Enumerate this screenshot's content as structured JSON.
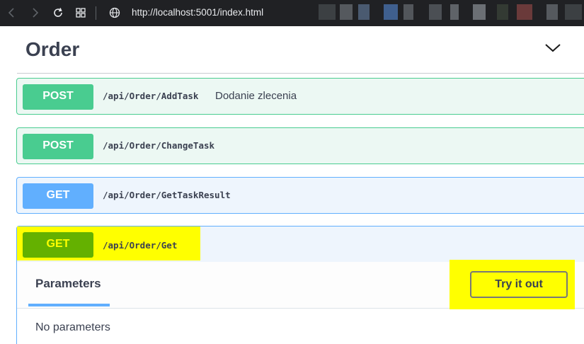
{
  "browser": {
    "url": "http://localhost:5001/index.html",
    "back_icon": "back-arrow-icon",
    "forward_icon": "forward-arrow-icon",
    "refresh_icon": "refresh-icon",
    "tabs_icon": "tab-grid-icon",
    "site_icon": "globe-icon"
  },
  "tag": {
    "title": "Order",
    "toggle_icon": "chevron-down-icon"
  },
  "operations": [
    {
      "method": "POST",
      "path": "/api/Order/AddTask",
      "summary": "Dodanie zlecenia"
    },
    {
      "method": "POST",
      "path": "/api/Order/ChangeTask",
      "summary": ""
    },
    {
      "method": "GET",
      "path": "/api/Order/GetTaskResult",
      "summary": ""
    },
    {
      "method": "GET",
      "path": "/api/Order/Get",
      "summary": ""
    }
  ],
  "expanded": {
    "parameters_tab": "Parameters",
    "try_button": "Try it out",
    "no_params_text": "No parameters"
  },
  "colors": {
    "post": "#49cc90",
    "get": "#61affe",
    "highlight": "#ffff00",
    "text": "#3b4151",
    "browser_bg": "#202124"
  }
}
